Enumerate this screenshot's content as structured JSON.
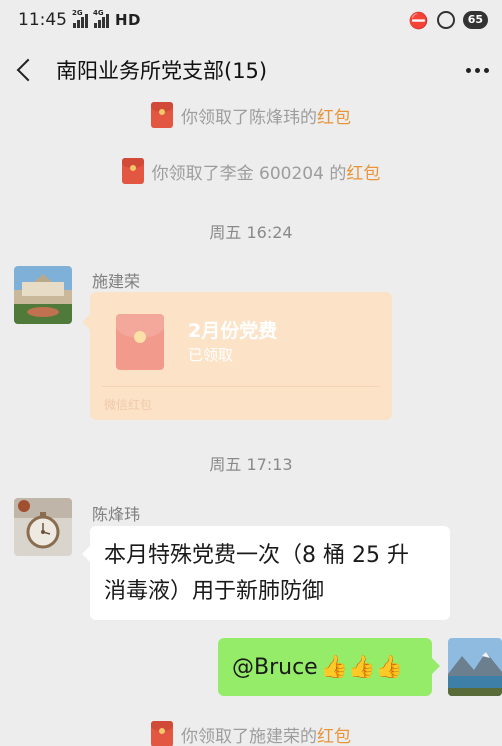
{
  "status_bar": {
    "time": "11:45",
    "net1": "2G",
    "net2": "4G",
    "hd": "HD",
    "battery": "65"
  },
  "header": {
    "title": "南阳业务所党支部(15)"
  },
  "notices": [
    {
      "prefix": "你领取了陈烽玮的",
      "highlight": "红包"
    },
    {
      "prefix": "你领取了李金 600204 的",
      "highlight": "红包"
    },
    {
      "prefix": "你领取了施建荣的",
      "highlight": "红包"
    }
  ],
  "timestamps": [
    "周五 16:24",
    "周五 17:13"
  ],
  "messages": [
    {
      "sender": "施建荣",
      "hongbao": {
        "title": "2月份党费",
        "status": "已领取",
        "footer": "微信红包"
      }
    },
    {
      "sender": "陈烽玮",
      "text_line1": "本月特殊党费一次（8 桶 25 升",
      "text_line2": "消毒液）用于新肺防御"
    },
    {
      "text": "@Bruce",
      "emoji": "👍👍👍"
    }
  ],
  "colors": {
    "background": "#ededed",
    "green_bubble": "#95ec69",
    "hongbao": "#fce3c8",
    "highlight": "#e8943a"
  }
}
